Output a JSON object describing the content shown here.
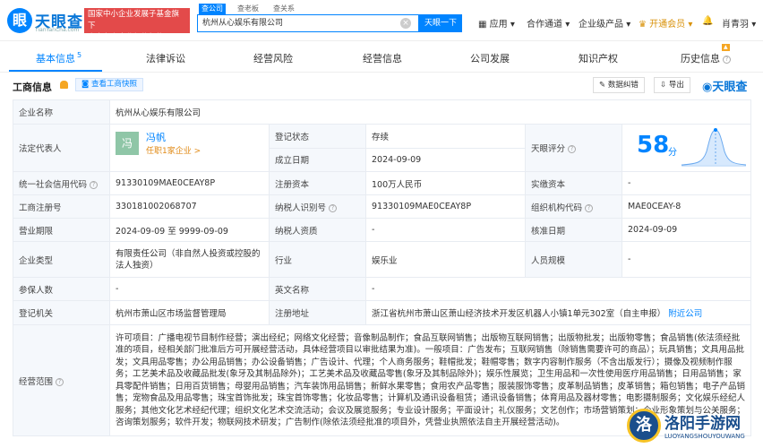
{
  "brand": {
    "logo_glyph": "眼",
    "name": "天眼查",
    "domain": "TianYanCha.com",
    "badge_line1": "国家中小企业发展子基金旗下",
    "badge_line2": "官方备案企业征信机构"
  },
  "search": {
    "tabs": [
      "查公司",
      "查老板",
      "查关系"
    ],
    "value": "杭州从心娱乐有限公司",
    "button": "天眼一下"
  },
  "nav": {
    "items": [
      "应用",
      "合作通道",
      "企业级产品",
      "开通会员",
      "肖青羽"
    ]
  },
  "tabs": {
    "items": [
      "基本信息",
      "法律诉讼",
      "经营风险",
      "经营信息",
      "公司发展",
      "知识产权",
      "历史信息"
    ],
    "basic_count": "5"
  },
  "section": {
    "title": "工商信息",
    "snapshot": "查看工商快照",
    "correct": "数据纠错",
    "export": "导出",
    "watermark": "天眼查"
  },
  "company": {
    "name_label": "企业名称",
    "name": "杭州从心娱乐有限公司",
    "legal_label": "法定代表人",
    "legal_avatar": "冯",
    "legal_name": "冯帆",
    "legal_sub": "任职1家企业 >",
    "reg_status_label": "登记状态",
    "reg_status": "存续",
    "score_label": "天眼评分",
    "score": "58",
    "score_unit": "分",
    "est_date_label": "成立日期",
    "est_date": "2024-09-09",
    "credit_code_label": "统一社会信用代码",
    "credit_code": "91330109MAE0CEAY8P",
    "reg_capital_label": "注册资本",
    "reg_capital": "100万人民币",
    "paid_capital_label": "实缴资本",
    "paid_capital": "-",
    "reg_no_label": "工商注册号",
    "reg_no": "330181002068707",
    "tax_id_label": "纳税人识别号",
    "tax_id": "91330109MAE0CEAY8P",
    "org_code_label": "组织机构代码",
    "org_code": "MAE0CEAY-8",
    "term_label": "营业期限",
    "term": "2024-09-09 至 9999-09-09",
    "taxpayer_label": "纳税人资质",
    "taxpayer": "-",
    "approve_label": "核准日期",
    "approve": "2024-09-09",
    "type_label": "企业类型",
    "type": "有限责任公司（非自然人投资或控股的法人独资）",
    "industry_label": "行业",
    "industry": "娱乐业",
    "staff_label": "人员规模",
    "staff": "-",
    "insured_label": "参保人数",
    "insured": "-",
    "en_name_label": "英文名称",
    "en_name": "-",
    "authority_label": "登记机关",
    "authority": "杭州市萧山区市场监督管理局",
    "address_label": "注册地址",
    "address": "浙江省杭州市萧山区萧山经济技术开发区机器人小镇1单元302室（自主申报）",
    "nearby": "附近公司",
    "scope_label": "经营范围",
    "scope": "许可项目：广播电视节目制作经营；演出经纪；网络文化经营；音像制品制作；食品互联网销售；出版物互联网销售；出版物批发；出版物零售；食品销售(依法须经批准的项目，经相关部门批准后方可开展经营活动，具体经营项目以审批结果为准)。一般项目：广告发布；互联网销售（除销售需要许可的商品）；玩具销售；文具用品批发；文具用品零售；办公用品销售；办公设备销售；广告设计、代理；个人商务服务；鞋帽批发；鞋帽零售；数字内容制作服务（不含出版发行）；摄像及视频制作服务；工艺美术品及收藏品批发(象牙及其制品除外)；工艺美术品及收藏品零售(象牙及其制品除外)；娱乐性展览；卫生用品和一次性使用医疗用品销售；日用品销售；家具零配件销售；日用百货销售；母婴用品销售；汽车装饰用品销售；新鲜水果零售；食用农产品零售；服装服饰零售；皮革制品销售；皮革销售；箱包销售；电子产品销售；宠物食品及用品零售；珠宝首饰批发；珠宝首饰零售；化妆品零售；计算机及通讯设备租赁；通讯设备销售；体育用品及器材零售；电影摄制服务；文化娱乐经纪人服务；其他文化艺术经纪代理；组织文化艺术交流活动；会议及展览服务；专业设计服务；平面设计；礼仪服务；文艺创作；市场营销策划；企业形象策划与公关服务；咨询策划服务；软件开发；物联网技术研发；广告制作(除依法须经批准的项目外，凭营业执照依法自主开展经营活动)。"
  },
  "site_watermark": {
    "glyph": "洛",
    "title": "洛阳手游网",
    "url": "LUOYANGSHOUYOUWANG"
  },
  "colors": {
    "accent": "#0084ff",
    "vip": "#d9920a",
    "status_green": "#1aad19",
    "badge_red": "#e34a4a"
  }
}
